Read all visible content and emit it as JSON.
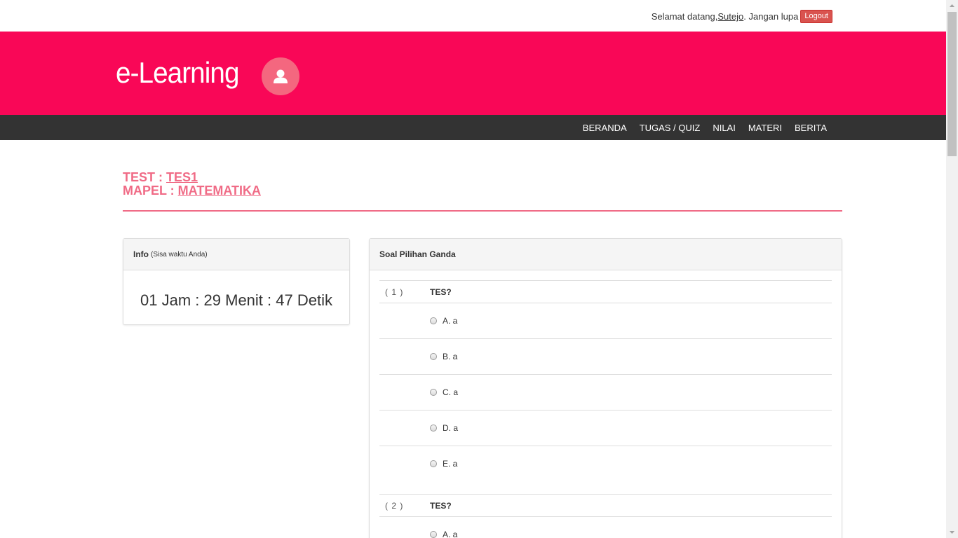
{
  "topbar": {
    "greeting": "Selamat datang, ",
    "username": "Sutejo",
    "reminder": ". Jangan lupa",
    "logout_label": "Logout"
  },
  "header": {
    "brand": "e-Learning"
  },
  "nav": {
    "items": [
      "BERANDA",
      "TUGAS / QUIZ",
      "NILAI",
      "MATERI",
      "BERITA"
    ]
  },
  "page": {
    "test_label": "TEST : ",
    "test_name": "TES1",
    "mapel_label": "MAPEL : ",
    "mapel_name": "MATEMATIKA"
  },
  "info": {
    "title": "Info",
    "subtitle": "(Sisa waktu Anda)",
    "timer": "01 Jam : 29 Menit : 47 Detik"
  },
  "questions": {
    "title": "Soal Pilihan Ganda",
    "items": [
      {
        "number": "( 1 )",
        "text": "TES?",
        "options": [
          "A. a",
          "B. a",
          "C. a",
          "D. a",
          "E. a"
        ]
      },
      {
        "number": "( 2 )",
        "text": "TES?",
        "options": [
          "A. a"
        ]
      }
    ]
  },
  "colors": {
    "header_bg": "#f90757",
    "nav_bg": "#333333",
    "accent": "#f06b86",
    "logout_bg": "#d9534f"
  }
}
